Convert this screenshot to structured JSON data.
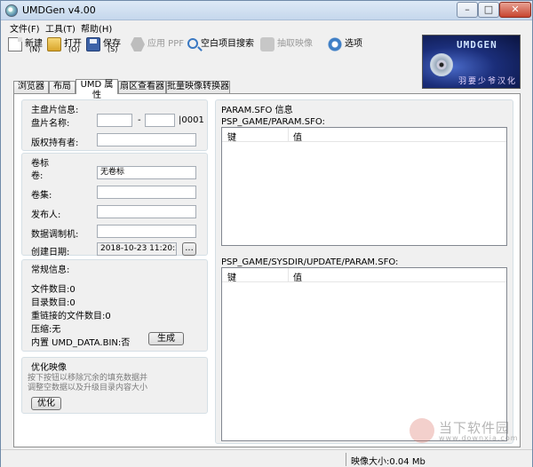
{
  "window": {
    "title": "UMDGen v4.00",
    "min_label": "–",
    "max_label": "□",
    "close_label": "✕"
  },
  "menu": [
    "文件(F)",
    "工具(T)",
    "帮助(H)"
  ],
  "toolbar": {
    "new_label": "新建",
    "new_key": "(N)",
    "open_label": "打开",
    "open_key": "(O)",
    "save_label": "保存",
    "save_key": "(S)",
    "apply_pbp": "应用 PPF",
    "blank_search": "空白项目搜索",
    "extract_image": "抽取映像",
    "options": "选项"
  },
  "logo": {
    "brand": "UMDGEN",
    "team": "羽要少爷汉化"
  },
  "tabs": [
    "浏览器",
    "布局",
    "UMD 属性",
    "扇区查看器",
    "批量映像转换器"
  ],
  "main_disc": {
    "heading": "主盘片信息:",
    "disc_name_label": "盘片名称:",
    "disc_name_sep": "-",
    "disc_name_suffix": "|0001",
    "copyright_label": "版权持有者:"
  },
  "volume": {
    "heading": "卷标",
    "volume_label": "卷:",
    "volume_value": "无卷标",
    "set_label": "卷集:",
    "publisher_label": "发布人:",
    "preparer_label": "数据调制机:",
    "created_label": "创建日期:",
    "created_value": "2018-10-23 11:20:29",
    "created_button": "..."
  },
  "general": {
    "heading": "常规信息:",
    "files": "文件数目:0",
    "dirs": "目录数目:0",
    "relinked": "重链接的文件数目:0",
    "compression": "压缩:无",
    "builtin_data": "内置 UMD_DATA.BIN:否",
    "generate_button": "生成"
  },
  "optimize": {
    "heading": "优化映像",
    "desc_line1": "按下按钮以移除冗余的填充数据并",
    "desc_line2": "调整空数据以及升级目录内容大小",
    "button": "优化"
  },
  "param_sfo": {
    "heading": "PARAM.SFO 信息",
    "game_path": "PSP_GAME/PARAM.SFO:",
    "update_path": "PSP_GAME/SYSDIR/UPDATE/PARAM.SFO:",
    "col_key": "键",
    "col_value": "值"
  },
  "status": {
    "image_size": "映像大小:0.04 Mb"
  },
  "watermark": {
    "cn": "当下软件园",
    "url": "www.downxia.com"
  }
}
